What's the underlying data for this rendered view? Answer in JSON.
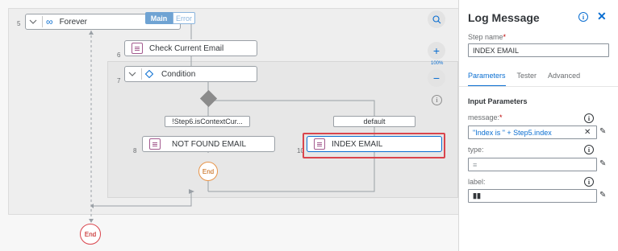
{
  "canvas": {
    "forever_step": {
      "number": "5",
      "label": "Forever"
    },
    "tags": {
      "main": "Main",
      "error": "Error"
    },
    "check_step": {
      "number": "6",
      "label": "Check Current Email"
    },
    "condition_step": {
      "number": "7",
      "label": "Condition"
    },
    "branches": {
      "left": "!Step6.isContextCur...",
      "right": "default"
    },
    "not_found_step": {
      "number": "8",
      "label": "NOT FOUND EMAIL"
    },
    "index_step": {
      "number": "10",
      "label": "INDEX EMAIL"
    },
    "end_inner": "End",
    "end_outer": "End",
    "zoom": {
      "percent": "100%"
    },
    "accent_color": "#0a6ed1",
    "highlight_color": "#d9454d"
  },
  "panel": {
    "title": "Log Message",
    "step_name_label": "Step name",
    "step_name_value": "INDEX EMAIL",
    "tabs": [
      {
        "label": "Parameters",
        "active": true
      },
      {
        "label": "Tester",
        "active": false
      },
      {
        "label": "Advanced",
        "active": false
      }
    ],
    "section_title": "Input Parameters",
    "fields": {
      "message": {
        "label": "message:",
        "value": "\"Index is \" + Step5.index"
      },
      "type": {
        "label": "type:",
        "value": ""
      },
      "label": {
        "label": "label:",
        "value": ""
      }
    }
  }
}
